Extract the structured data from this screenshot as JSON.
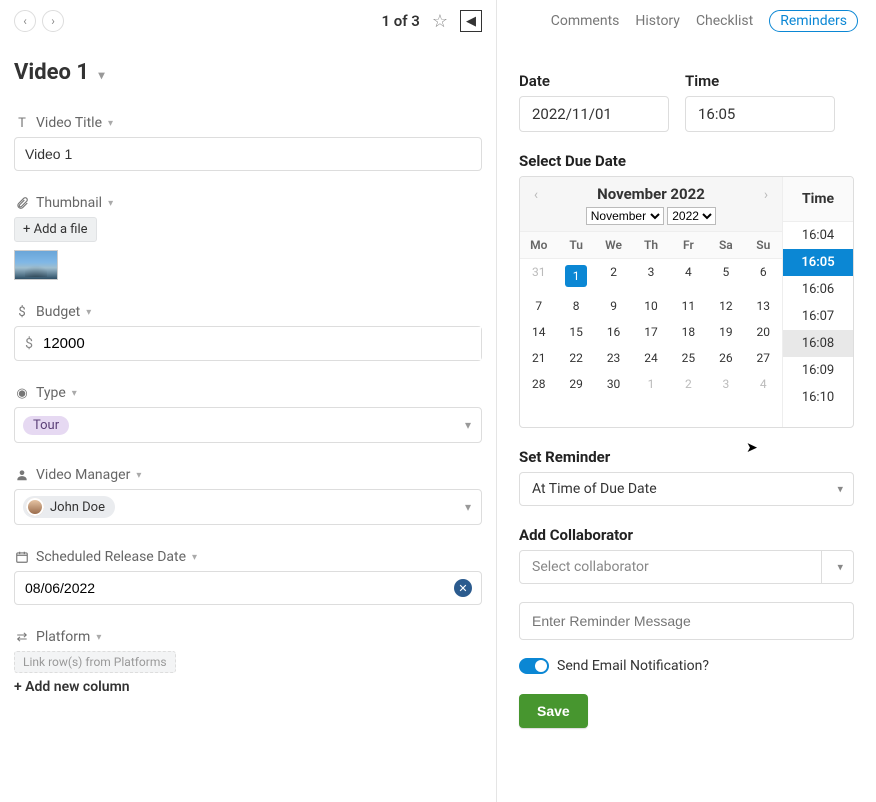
{
  "header": {
    "counter": "1 of 3"
  },
  "record": {
    "title": "Video 1"
  },
  "fields": {
    "video_title": {
      "label": "Video Title",
      "value": "Video 1"
    },
    "thumbnail": {
      "label": "Thumbnail",
      "add_file": "+ Add a file"
    },
    "budget": {
      "label": "Budget",
      "prefix": "$",
      "value": "12000"
    },
    "type": {
      "label": "Type",
      "value": "Tour"
    },
    "video_manager": {
      "label": "Video Manager",
      "value": "John Doe"
    },
    "scheduled_release_date": {
      "label": "Scheduled Release Date",
      "value": "08/06/2022"
    },
    "platform": {
      "label": "Platform",
      "link_placeholder": "Link row(s) from Platforms"
    },
    "add_new_column": "+ Add new column"
  },
  "right_tabs": {
    "comments": "Comments",
    "history": "History",
    "checklist": "Checklist",
    "reminders": "Reminders"
  },
  "reminder": {
    "date_label": "Date",
    "time_label": "Time",
    "date_value": "2022/11/01",
    "time_value": "16:05",
    "select_due_date": "Select Due Date",
    "calendar": {
      "title": "November 2022",
      "month_select": "November",
      "year_select": "2022",
      "weekdays": [
        "Mo",
        "Tu",
        "We",
        "Th",
        "Fr",
        "Sa",
        "Su"
      ],
      "rows": [
        [
          "31",
          "1",
          "2",
          "3",
          "4",
          "5",
          "6"
        ],
        [
          "7",
          "8",
          "9",
          "10",
          "11",
          "12",
          "13"
        ],
        [
          "14",
          "15",
          "16",
          "17",
          "18",
          "19",
          "20"
        ],
        [
          "21",
          "22",
          "23",
          "24",
          "25",
          "26",
          "27"
        ],
        [
          "28",
          "29",
          "30",
          "1",
          "2",
          "3",
          "4"
        ]
      ],
      "selected_day": "1",
      "off_cells": [
        "0:0",
        "4:3",
        "4:4",
        "4:5",
        "4:6"
      ]
    },
    "time_column_header": "Time",
    "time_list": [
      "16:04",
      "16:05",
      "16:06",
      "16:07",
      "16:08",
      "16:09",
      "16:10"
    ],
    "time_selected": "16:05",
    "time_hover": "16:08",
    "set_reminder_label": "Set Reminder",
    "set_reminder_value": "At Time of Due Date",
    "add_collaborator_label": "Add Collaborator",
    "add_collaborator_placeholder": "Select collaborator",
    "message_placeholder": "Enter Reminder Message",
    "email_toggle_label": "Send Email Notification?",
    "save_label": "Save"
  }
}
